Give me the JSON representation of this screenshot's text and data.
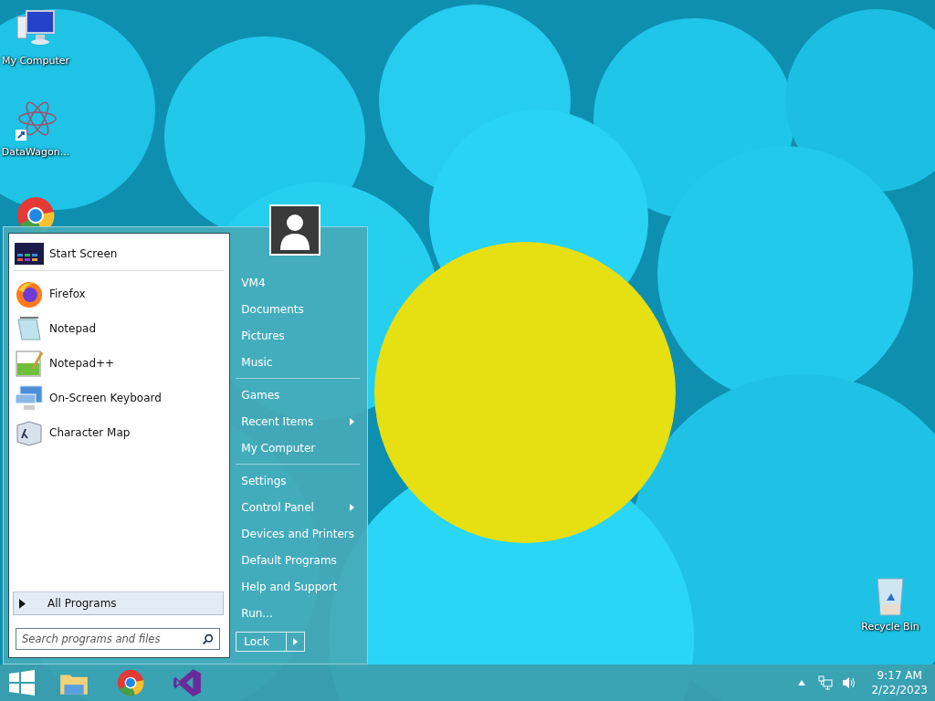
{
  "desktop_icons": [
    {
      "kind": "computer",
      "label": "My Computer"
    },
    {
      "kind": "shortcut",
      "label": "DataWagon..."
    },
    {
      "kind": "chrome"
    },
    {
      "kind": "recycle",
      "label": "Recycle Bin"
    }
  ],
  "start_menu": {
    "programs": [
      {
        "kind": "start",
        "label": "Start Screen"
      },
      {
        "kind": "firefox",
        "label": "Firefox"
      },
      {
        "kind": "notepad",
        "label": "Notepad"
      },
      {
        "kind": "notepadpp",
        "label": "Notepad++"
      },
      {
        "kind": "keyboard",
        "label": "On-Screen Keyboard"
      },
      {
        "kind": "charmap",
        "label": "Character Map"
      }
    ],
    "all_programs": "All Programs",
    "search": {
      "placeholder": "Search programs and files"
    },
    "places": [
      [
        {
          "label": "VM4",
          "submenu": false
        },
        {
          "label": "Documents",
          "submenu": false
        },
        {
          "label": "Pictures",
          "submenu": false
        },
        {
          "label": "Music",
          "submenu": false
        }
      ],
      [
        {
          "label": "Games",
          "submenu": false
        },
        {
          "label": "Recent Items",
          "submenu": true
        },
        {
          "label": "My Computer",
          "submenu": false
        }
      ],
      [
        {
          "label": "Settings",
          "submenu": false
        },
        {
          "label": "Control Panel",
          "submenu": true
        },
        {
          "label": "Devices and Printers",
          "submenu": false
        },
        {
          "label": "Default Programs",
          "submenu": false
        },
        {
          "label": "Help and Support",
          "submenu": false
        },
        {
          "label": "Run...",
          "submenu": false
        }
      ]
    ],
    "lock_button": "Lock"
  },
  "taskbar": {
    "pinned": [
      {
        "kind": "explorer"
      },
      {
        "kind": "chrome"
      },
      {
        "kind": "visualstudio"
      }
    ],
    "time": "9:17 AM",
    "date": "2/22/2023"
  }
}
